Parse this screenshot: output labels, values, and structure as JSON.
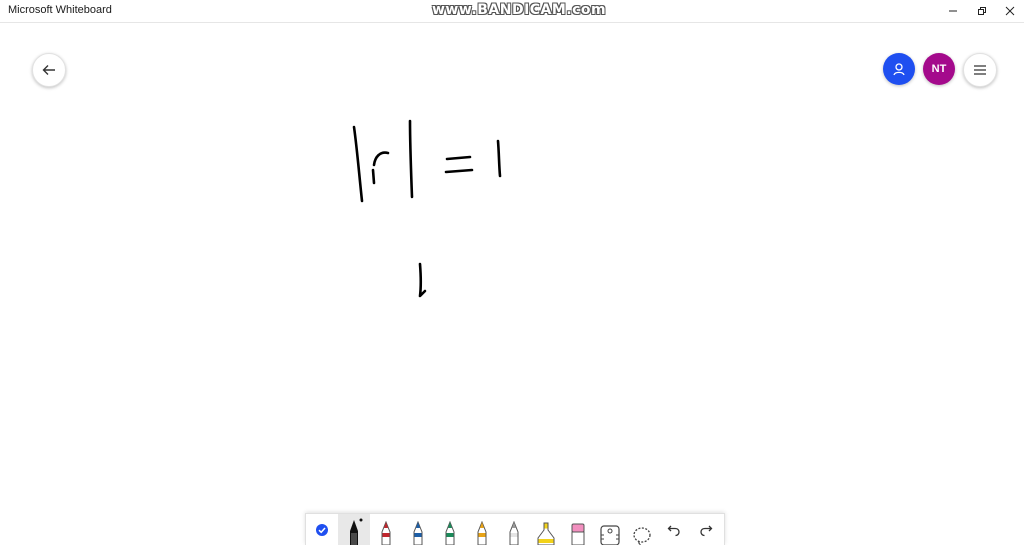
{
  "window": {
    "title": "Microsoft Whiteboard",
    "watermark": "www.BANDICAM.com",
    "controls": [
      "minimize-icon",
      "restore-icon",
      "close-icon"
    ]
  },
  "header": {
    "back_icon": "arrow-left-icon",
    "share_icon": "person-icon",
    "avatar_initials": "NT",
    "menu_icon": "hamburger-icon",
    "colors": {
      "share": "#1f4ff0",
      "avatar": "#a40a8c"
    }
  },
  "canvas": {
    "ink_color": "#000000",
    "strokes_description": [
      "|r| = 1",
      "1"
    ]
  },
  "toolbar": {
    "tools": [
      {
        "name": "select-check-icon",
        "color": "#1f4ff0"
      },
      {
        "name": "pen-black-icon",
        "color": "#111111",
        "selected": true
      },
      {
        "name": "pen-red-icon",
        "color": "#c0262d"
      },
      {
        "name": "pen-blue-icon",
        "color": "#1d5fa8"
      },
      {
        "name": "pen-green-icon",
        "color": "#1b8a5a"
      },
      {
        "name": "pen-orange-icon",
        "color": "#e8a317"
      },
      {
        "name": "pen-gray-icon",
        "color": "#9a9a9a"
      },
      {
        "name": "highlighter-yellow-icon",
        "color": "#f2d21a"
      },
      {
        "name": "eraser-icon",
        "color": "#f28fbf"
      },
      {
        "name": "ruler-icon",
        "color": "#555555"
      },
      {
        "name": "lasso-icon",
        "color": "#555555"
      },
      {
        "name": "undo-icon",
        "color": "#333333"
      },
      {
        "name": "redo-icon",
        "color": "#333333"
      }
    ]
  }
}
